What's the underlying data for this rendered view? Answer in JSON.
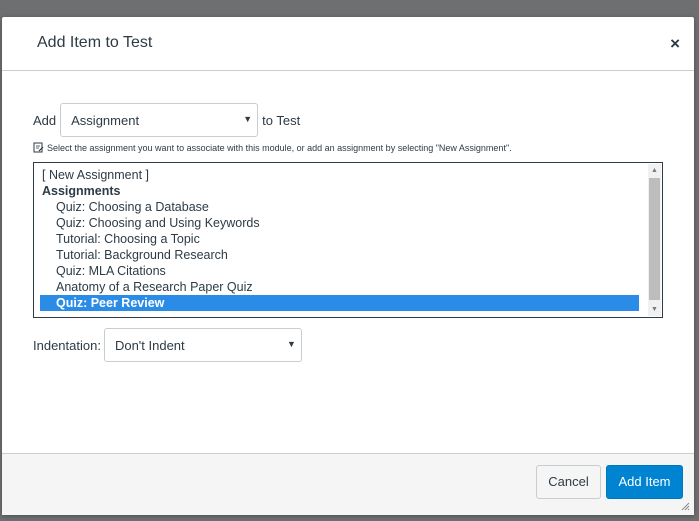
{
  "dialog": {
    "title": "Add Item to Test",
    "close_label": "×"
  },
  "add_row": {
    "prefix": "Add",
    "type_selected": "Assignment",
    "suffix": "to Test"
  },
  "hint": {
    "text": "Select the assignment you want to associate with this module, or add an assignment by selecting \"New Assignment\".",
    "icon": "edit-note-icon"
  },
  "assignment_list": {
    "new_option": "[ New Assignment ]",
    "group_label": "Assignments",
    "items": [
      "Quiz: Choosing a Database",
      "Quiz: Choosing and Using Keywords",
      "Tutorial: Choosing a Topic",
      "Tutorial: Background Research",
      "Quiz: MLA Citations",
      "Anatomy of a Research Paper Quiz",
      "Quiz: Peer Review"
    ],
    "selected_index": 6
  },
  "indent_row": {
    "label": "Indentation:",
    "selected": "Don't Indent"
  },
  "footer": {
    "cancel_label": "Cancel",
    "add_label": "Add Item"
  },
  "colors": {
    "primary": "#0084d1",
    "selection": "#2b8ce8",
    "text": "#2d3b45"
  }
}
